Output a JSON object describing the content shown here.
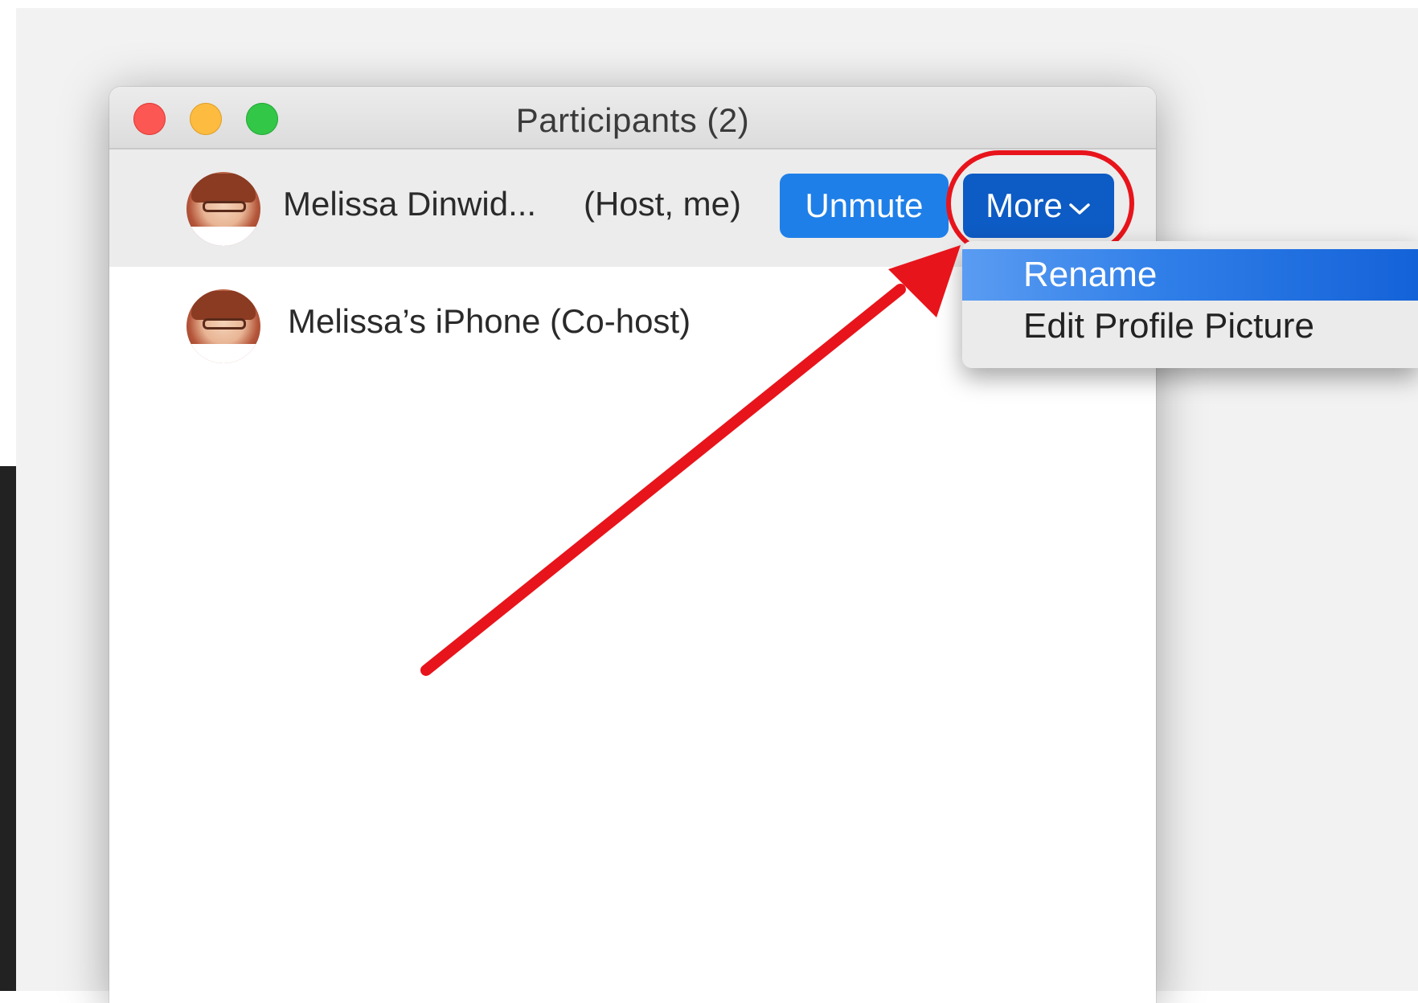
{
  "window": {
    "title": "Participants (2)"
  },
  "participants": [
    {
      "name": "Melissa Dinwid...",
      "role": "(Host, me)",
      "actions": {
        "unmute_label": "Unmute",
        "more_label": "More"
      }
    },
    {
      "name": "Melissa’s iPhone (Co-host)"
    }
  ],
  "more_menu": {
    "items": [
      {
        "label": "Rename",
        "state": "highlighted"
      },
      {
        "label": "Edit Profile Picture"
      }
    ]
  },
  "colors": {
    "accent_blue": "#1f7fe8",
    "more_button_blue": "#0d5bc4",
    "annotation_red": "#e8141b",
    "traffic_close": "#fc5753",
    "traffic_minimize": "#fdbc40",
    "traffic_zoom": "#33c748"
  },
  "icons": {
    "more_chevron": "chevron-down-icon",
    "annotation": "red-arrow-annotation"
  }
}
